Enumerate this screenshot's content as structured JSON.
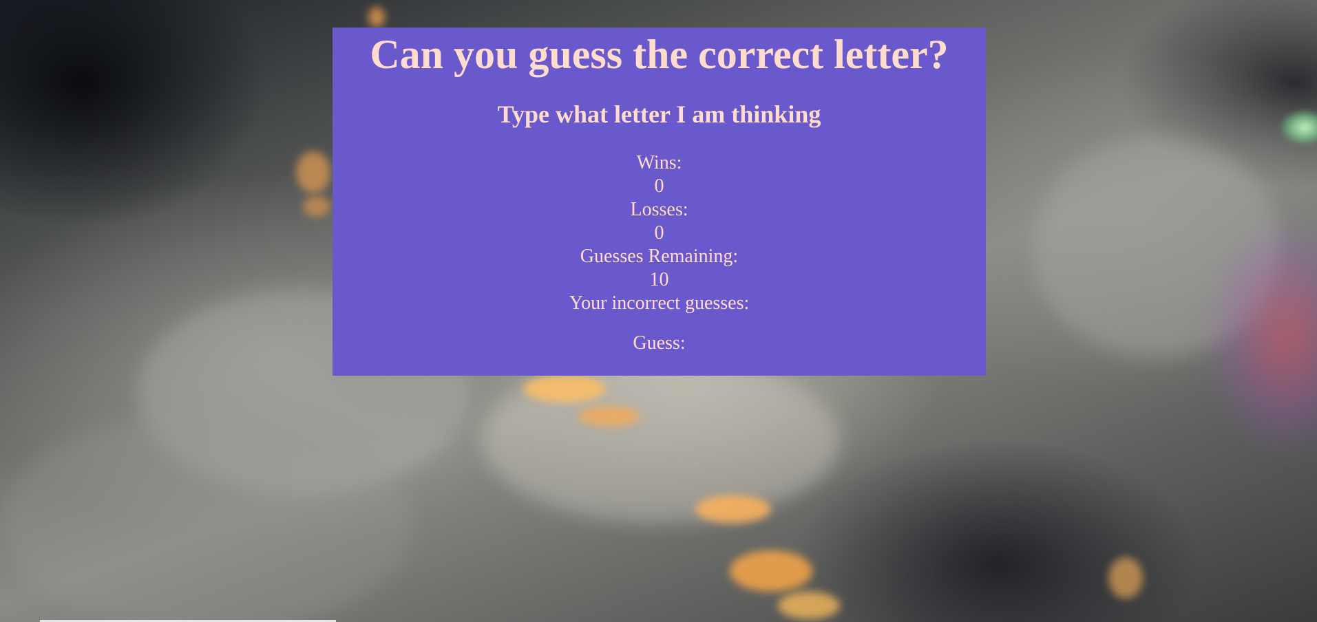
{
  "page": {
    "background_image": "earth-at-night-from-space",
    "panel_color": "#6a59cd",
    "text_color": "#ffdccb"
  },
  "game": {
    "title": "Can you guess the correct letter?",
    "subtitle": "Type what letter I am thinking",
    "wins_label": "Wins:",
    "wins_value": "0",
    "losses_label": "Losses:",
    "losses_value": "0",
    "guesses_remaining_label": "Guesses Remaining:",
    "guesses_remaining_value": "10",
    "incorrect_guesses_label": "Your incorrect guesses:",
    "incorrect_guesses_value": "",
    "guess_label": "Guess:",
    "guess_value": ""
  }
}
